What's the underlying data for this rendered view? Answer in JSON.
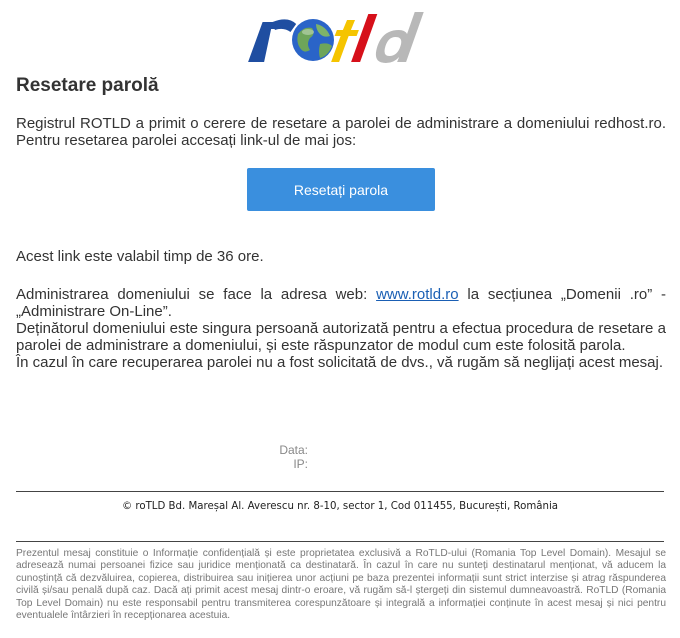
{
  "logo": {
    "text": "rotld",
    "colors": {
      "blue": "#1f4ea1",
      "yellow": "#f5c400",
      "red": "#d6101a",
      "grey": "#b8b8b8"
    }
  },
  "email": {
    "title": "Resetare parolă",
    "intro": "Registrul ROTLD a primit o cerere de resetare a parolei de administrare a domeniului redhost.ro. Pentru resetarea parolei accesați link-ul de mai jos:",
    "reset_button": "Resetați parola",
    "validity": "Acest link este valabil timp de 36 ore.",
    "admin_prefix": "Administrarea domeniului se face la adresa web:",
    "admin_link": "www.rotld.ro",
    "admin_suffix": "la secțiunea „Domenii .ro” - „Administrare On-Line”.",
    "owner_notice": "Deținătorul domeniului este singura persoană autorizată pentru a efectua procedura de resetare a parolei de administrare a domeniului, și este răspunzator de modul cum este folosită parola.",
    "ignore_notice": "În cazul în care recuperarea parolei nu a fost solicitată de dvs., vă rugăm să neglijați acest mesaj.",
    "date_label": "Data:",
    "ip_label": "IP:"
  },
  "footer": {
    "address": "© roTLD Bd. Mareșal Al. Averescu nr. 8-10, sector 1, Cod 011455, București, România",
    "legal": "Prezentul mesaj constituie o Informație confidențială și este proprietatea exclusivă a RoTLD-ului (Romania Top Level Domain). Mesajul se adresează numai persoanei fizice sau juridice menționată ca destinatară. În cazul în care nu sunteți destinatarul menționat, vă aducem la cunoștință că dezvăluirea, copierea, distribuirea sau inițierea unor acțiuni pe baza prezentei informații sunt strict interzise și atrag răspunderea civilă și/sau penală după caz. Dacă ați primit acest mesaj dintr-o eroare, vă rugăm să-l ștergeți din sistemul dumneavoastră. RoTLD (Romania Top Level Domain) nu este responsabil pentru transmiterea corespunzătoare și integrală a informației conținute în acest mesaj și nici pentru eventualele întârzieri în recepționarea acestuia."
  }
}
